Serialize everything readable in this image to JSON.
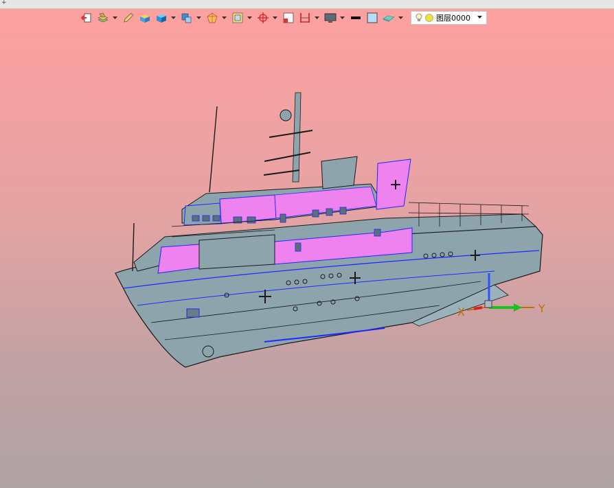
{
  "window": {
    "corner_glyph": "+"
  },
  "toolbar": {
    "buttons": [
      {
        "id": "new-layer",
        "icon": "layer-new-icon",
        "dropdown": false
      },
      {
        "id": "layer-manager",
        "icon": "layer-stack-icon",
        "dropdown": true
      },
      {
        "id": "pencil",
        "icon": "pencil-icon",
        "dropdown": false
      },
      {
        "id": "layer-state",
        "icon": "cube-yellow-icon",
        "dropdown": false
      },
      {
        "id": "solid-display",
        "icon": "cube-blue-icon",
        "dropdown": true
      },
      {
        "id": "view-style",
        "icon": "cube-view-icon",
        "dropdown": true
      },
      {
        "id": "render-mode",
        "icon": "shape-render-icon",
        "dropdown": true
      },
      {
        "id": "section-view",
        "icon": "box-frame-icon",
        "dropdown": true
      },
      {
        "id": "snap",
        "icon": "snap-target-icon",
        "dropdown": true
      },
      {
        "id": "grid",
        "icon": "grid-square-icon",
        "dropdown": false
      },
      {
        "id": "dimension",
        "icon": "dimension-icon",
        "dropdown": true
      },
      {
        "id": "monitor",
        "icon": "monitor-icon",
        "dropdown": true
      },
      {
        "id": "line-weight",
        "icon": "line-weight-icon",
        "dropdown": false
      },
      {
        "id": "fill-color",
        "icon": "color-swatch-icon",
        "dropdown": false
      },
      {
        "id": "plane",
        "icon": "plane-icon",
        "dropdown": true
      }
    ],
    "layer": {
      "name": "图层0000",
      "bulb_icon": "lightbulb-icon",
      "state_icon": "sun-icon"
    }
  },
  "viewport": {
    "background_top": "#ffa0a0",
    "background_bottom": "#b0a3a6",
    "model": "ship-hull-icon",
    "triad": {
      "x_label": "X",
      "y_label": "Y"
    }
  },
  "colors": {
    "hull": "#8ea4ad",
    "edge_blue": "#1e28ff",
    "highlight": "#ee82ee",
    "outline": "#1a1a1a"
  }
}
